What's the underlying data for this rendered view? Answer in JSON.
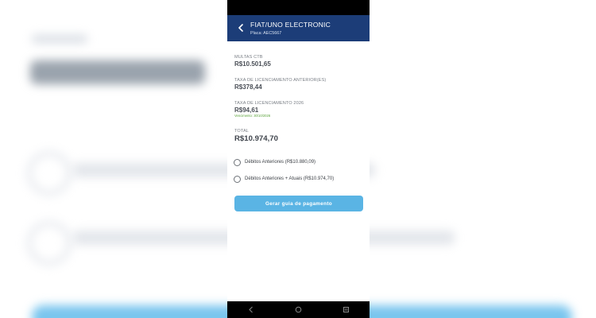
{
  "header": {
    "title": "FIAT/UNO ELECTRONIC",
    "plate": "Placa: AEC5667",
    "icon": "chevron-left-icon"
  },
  "debts": {
    "multas": {
      "label": "MULTAS CTB",
      "value": "R$10.501,65"
    },
    "anteriores": {
      "label": "TAXA DE LICENCIAMENTO ANTERIOR(ES)",
      "value": "R$378,44"
    },
    "atual": {
      "label": "TAXA DE LICENCIAMENTO 2026",
      "value": "R$94,61",
      "due": "Vencimento: 30/10/2026"
    },
    "total": {
      "label": "TOTAL",
      "value": "R$10.974,70"
    }
  },
  "options": [
    {
      "label": "Débitos Anteriores (R$10.880,09)",
      "selected": false
    },
    {
      "label": "Débitos Anteriores + Atuais (R$10.974,70)",
      "selected": false
    }
  ],
  "button": {
    "label": "Gerar guia de pagamento"
  },
  "navbar": {
    "icons": [
      "back-icon",
      "home-icon",
      "recents-icon"
    ]
  },
  "colors": {
    "header_bg": "#1c3d78",
    "button_bg": "#5ab4e4",
    "due_text": "#5aa33a"
  }
}
